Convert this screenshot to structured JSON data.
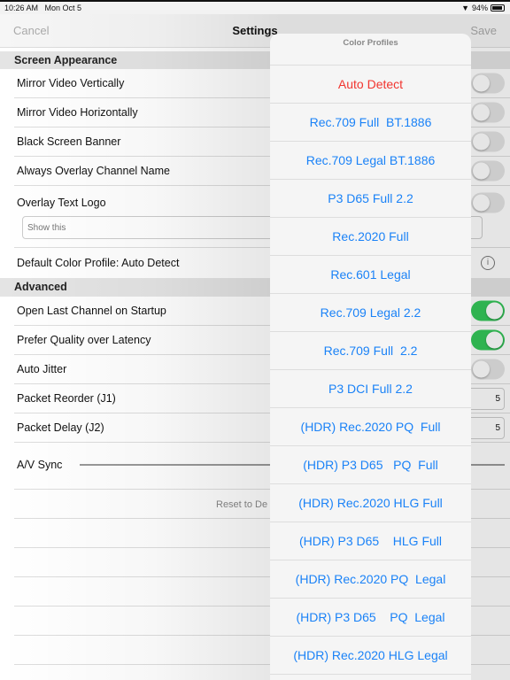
{
  "status": {
    "time": "10:26 AM",
    "date": "Mon Oct 5",
    "battery": "94%"
  },
  "nav": {
    "cancel": "Cancel",
    "title": "Settings",
    "save": "Save"
  },
  "sections": {
    "appearance": "Screen Appearance",
    "advanced": "Advanced"
  },
  "rows": {
    "mirror_v": {
      "label": "Mirror Video Vertically",
      "on": false
    },
    "mirror_h": {
      "label": "Mirror Video Horizontally",
      "on": false
    },
    "black": {
      "label": "Black Screen Banner",
      "on": false
    },
    "overlay_name": {
      "label": "Always Overlay Channel Name",
      "on": false
    },
    "text_logo": {
      "label": "Overlay Text Logo",
      "placeholder": "Show this",
      "on": false
    },
    "color_profile": {
      "label": "Default Color Profile:  Auto Detect"
    },
    "open_last": {
      "label": "Open Last Channel on Startup",
      "on": true
    },
    "quality": {
      "label": "Prefer Quality over Latency",
      "on": true
    },
    "jitter": {
      "label": "Auto Jitter",
      "on": false
    },
    "reorder": {
      "label": "Packet Reorder (J1)",
      "value": "5"
    },
    "delay": {
      "label": "Packet Delay (J2)",
      "value": "5"
    },
    "av_sync": {
      "label": "A/V Sync"
    },
    "reset": {
      "label": "Reset to De"
    }
  },
  "popover": {
    "title": "Color Profiles",
    "selected": "Auto Detect",
    "items": [
      "Auto Detect",
      "Rec.709 Full  BT.1886",
      "Rec.709 Legal BT.1886",
      "P3 D65 Full 2.2",
      "Rec.2020 Full",
      "Rec.601 Legal",
      "Rec.709 Legal 2.2",
      "Rec.709 Full  2.2",
      "P3 DCI Full 2.2",
      "(HDR) Rec.2020 PQ  Full",
      "(HDR) P3 D65   PQ  Full",
      "(HDR) Rec.2020 HLG Full",
      "(HDR) P3 D65    HLG Full",
      "(HDR) Rec.2020 PQ  Legal",
      "(HDR) P3 D65    PQ  Legal",
      "(HDR) Rec.2020 HLG Legal"
    ]
  },
  "colors": {
    "accent": "#1a82f7",
    "selected": "#f2352f",
    "toggle_on": "#34c759"
  }
}
